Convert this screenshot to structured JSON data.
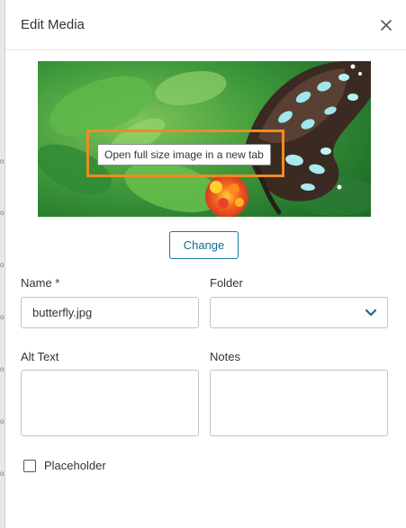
{
  "dialog": {
    "title": "Edit Media",
    "close_icon": "close-icon"
  },
  "preview": {
    "tooltip": "Open full size image in a new tab",
    "change_label": "Change"
  },
  "form": {
    "name_label": "Name *",
    "name_value": "butterfly.jpg",
    "folder_label": "Folder",
    "folder_value": "",
    "alt_text_label": "Alt Text",
    "alt_text_value": "",
    "notes_label": "Notes",
    "notes_value": "",
    "placeholder_label": "Placeholder",
    "placeholder_checked": false
  },
  "backdrop": {
    "marks": [
      "n",
      "o",
      "o",
      "o",
      "o",
      "o",
      "o"
    ]
  },
  "colors": {
    "accent": "#146c8f",
    "highlight": "#f08a24"
  }
}
